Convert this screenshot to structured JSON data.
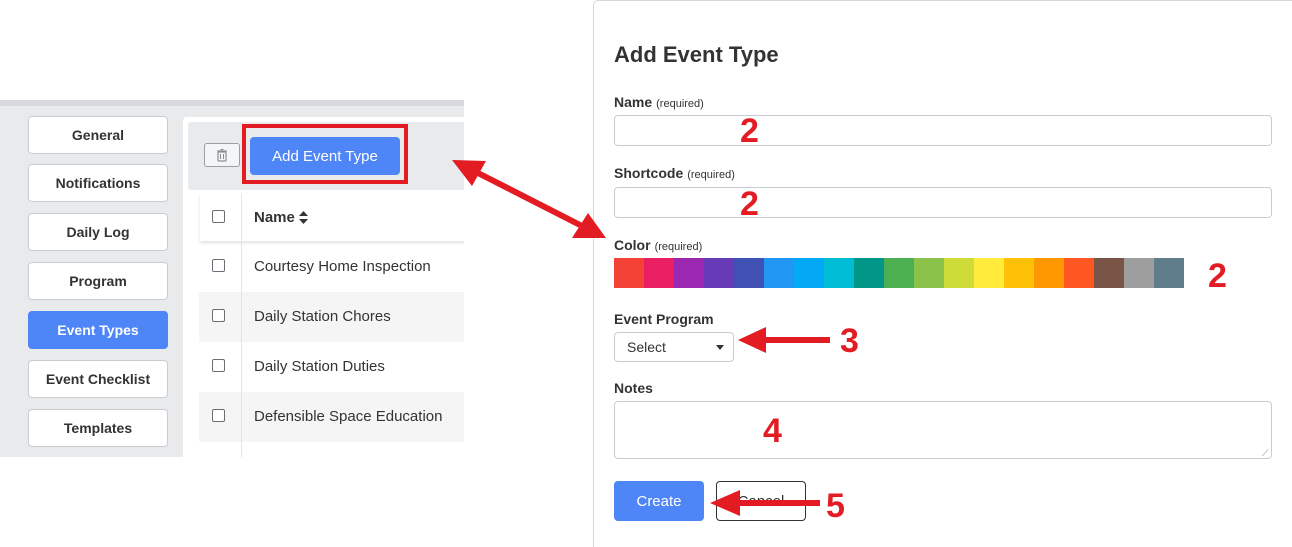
{
  "sidebar": {
    "items": [
      {
        "label": "General",
        "active": false
      },
      {
        "label": "Notifications",
        "active": false
      },
      {
        "label": "Daily Log",
        "active": false
      },
      {
        "label": "Program",
        "active": false
      },
      {
        "label": "Event Types",
        "active": true
      },
      {
        "label": "Event Checklist",
        "active": false
      },
      {
        "label": "Templates",
        "active": false
      }
    ]
  },
  "list": {
    "add_button_label": "Add Event Type",
    "trash_icon": "trash-icon",
    "column_name": "Name",
    "sort_icon": "sort-icon",
    "rows": [
      "Courtesy Home Inspection",
      "Daily Station Chores",
      "Daily Station Duties",
      "Defensible Space Education"
    ]
  },
  "modal": {
    "title": "Add Event Type",
    "name_label": "Name",
    "name_required": "(required)",
    "name_value": "",
    "shortcode_label": "Shortcode",
    "shortcode_required": "(required)",
    "shortcode_value": "",
    "color_label": "Color",
    "color_required": "(required)",
    "colors": [
      "#f44336",
      "#e91e63",
      "#9c27b0",
      "#673ab7",
      "#3f51b5",
      "#2196f3",
      "#03a9f4",
      "#00bcd4",
      "#009688",
      "#4caf50",
      "#8bc34a",
      "#cddc39",
      "#ffeb3b",
      "#ffc107",
      "#ff9800",
      "#ff5722",
      "#795548",
      "#9e9e9e",
      "#607d8b"
    ],
    "program_label": "Event Program",
    "program_selected": "Select",
    "notes_label": "Notes",
    "notes_value": "",
    "create_label": "Create",
    "cancel_label": "Cancel"
  },
  "annotations": {
    "name_num": "2",
    "shortcode_num": "2",
    "color_num": "2",
    "program_num": "3",
    "notes_num": "4",
    "create_num": "5",
    "accent": "#e31b23"
  }
}
